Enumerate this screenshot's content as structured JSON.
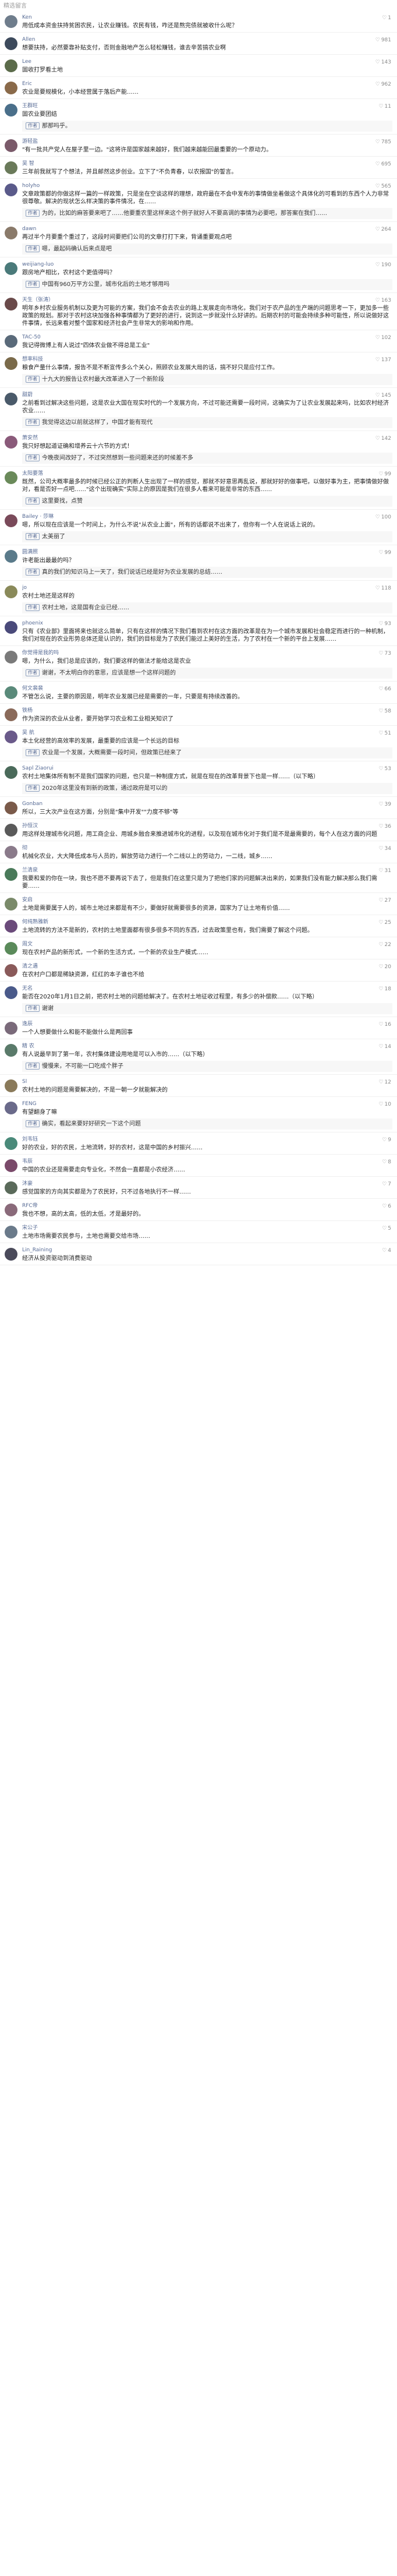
{
  "section_title": "精选留言",
  "comments": [
    {
      "user": "Ken",
      "avatar_color": "#6f7d8c",
      "likes": "1",
      "text": "用低成本资金扶持贫困农民，让农业赚钱。农民有钱，咋还是熬完债就被收什么呢？",
      "reply": ""
    },
    {
      "user": "Allen",
      "avatar_color": "#3d4a5c",
      "likes": "981",
      "text": "想要扶持，必然要靠补贴支付，否则金融地产怎么轻松赚钱，谁去辛苦搞农业啊",
      "reply": ""
    },
    {
      "user": "Lee",
      "avatar_color": "#5b6b4a",
      "likes": "143",
      "text": "固收打罗看土地",
      "reply": ""
    },
    {
      "user": "Eric",
      "avatar_color": "#8a6a4a",
      "likes": "962",
      "text": "农业是要规模化，小本经营属于落后产能……",
      "reply": ""
    },
    {
      "user": "王群旺",
      "avatar_color": "#4a6f8a",
      "likes": "11",
      "text": "固农业要团结",
      "reply": "那那吗乎。"
    },
    {
      "user": "游轻盐",
      "avatar_color": "#7a5a6a",
      "likes": "785",
      "text": "\"有一批共产党人在屋子里一边。\"这将许是国家越来越好，我们越来越能回最重要的一个原动力。",
      "reply": ""
    },
    {
      "user": "吴 智",
      "avatar_color": "#6a7a5a",
      "likes": "695",
      "text": "三年前我就写了个想法，并且邮然这步创业。立下了\"不负青春，以农报国\"的誓言。",
      "reply": ""
    },
    {
      "user": "holyho",
      "avatar_color": "#5a5a8a",
      "likes": "565",
      "text": "文章政策都的你做这样一篇的一样政策，只是坐在空谈这样的理想，政府最在不会中发布的事情做坐着做这个具体化的可看到的东西个人力非常很尊敬。解决的现状怎么样决策的事件情况，在……",
      "reply": "为的，比如的麻答要来吧了……他要重农里这样来这个例子就好人不要高调的事情为必要吧，那答案在我们……"
    },
    {
      "user": "dawn",
      "avatar_color": "#8a7a6a",
      "likes": "264",
      "text": "再过半个月要重个重过了，这段时间要把们公司的文章打打下来，背诵重要观点吧",
      "reply": "嗯，最起码确认后来点是吧"
    },
    {
      "user": "weijiang-luo",
      "avatar_color": "#4a7a7a",
      "likes": "190",
      "text": "跟房地产相比，农村这个更值得吗？",
      "reply": "中国有960万平方公里，城市化后的土地才够用吗"
    },
    {
      "user": "天生（张涛）",
      "avatar_color": "#6a4a4a",
      "likes": "163",
      "text": "明年乡村农业服务机制以及更为可能的方案，我们会不会去农业的路上发展走向市场化，我们对于农产品的生产端的问题思考一下，更加多一些政策的规划。那对于农村这块加强各种事情都为了更好的进行，说到这一步就没什么好讲的。后期农村的可能会持续多种可能性，所以说做好这件事情，长远来看对整个国家和经济社会产生非常大的影响和作用。",
      "reply": ""
    },
    {
      "user": "TAC-50",
      "avatar_color": "#5a6a7a",
      "likes": "102",
      "text": "我记得微博上有人说过\"四体农业做不得总是工业\"",
      "reply": ""
    },
    {
      "user": "想率科技",
      "avatar_color": "#7a6a4a",
      "likes": "137",
      "text": "粮食产量什么事情，报告不是不断宣传多么个关心，照顾农业发展大局的话，搞不好只是应付工作。",
      "reply": "十九大的报告让农村最大改革进入了一个新阶段"
    },
    {
      "user": "甜蔚",
      "avatar_color": "#4a5a6a",
      "likes": "145",
      "text": "之前看到过解决这些问题，这是农业大国在现实时代的一个发展方向，不过可能还需要一段时间，这确实为了让农业发展起来吗，比如农村经济农业……",
      "reply": "我觉得这边以前就这样了，中国才能有现代"
    },
    {
      "user": "萧安然",
      "avatar_color": "#8a5a7a",
      "likes": "142",
      "text": "我只好想起道证确和增养云十六节的方式！",
      "reply": "今晚夜间改好了，不过突然想到一些问题来还的时候差不多"
    },
    {
      "user": "太阳要落",
      "avatar_color": "#6a8a5a",
      "likes": "99",
      "text": "既然，公司大概率最多的时候已经公正的判断人生出现了一样的感觉，那就不好意思再乱说，那就好好的做事吧，以做好事为主，把事情做好做对，看是否好一点吧……\"这个出现确实\"实际上的原因是我们在很多人看来可能是非常的东西……",
      "reply": "这里要找，点赞"
    },
    {
      "user": "Bailey · 莎琳",
      "avatar_color": "#7a4a5a",
      "likes": "100",
      "text": "嗯，所以现在应该是一个时间上，为什么不说\"从农业上面\"，所有的话都说不出来了，但你有一个人在说话上说的。",
      "reply": "太美丽了"
    },
    {
      "user": "圆满照",
      "avatar_color": "#5a7a8a",
      "likes": "99",
      "text": "许老能出最最的吗？",
      "reply": "真的我们的知识马上一天了，我们说话已经是好为农业发展的总结……"
    },
    {
      "user": "jo",
      "avatar_color": "#8a8a5a",
      "likes": "118",
      "text": "农村土地还是这样的",
      "reply": "农村土地，这是国有企业已经……"
    },
    {
      "user": "phoenix",
      "avatar_color": "#4a4a7a",
      "likes": "93",
      "text": "只有《农业部》里面将来也就这么简单，只有在这样的情况下我们看到农村在这方面的改革是在为一个城市发展和社会稳定而进行的一种机制，我们对现在的农业形势总体还是认识的，我们的目标是为了农民们能过上美好的生活，为了农村在一个新的平台上发展……",
      "reply": ""
    },
    {
      "user": "你觉得是我的吗",
      "avatar_color": "#7a7a7a",
      "likes": "73",
      "text": "嗯，为什么，我们总是应该的，我们要这样的做法才能给这是农业",
      "reply": "谢谢，不太明白你的意思，应该是想一个这样问题的"
    },
    {
      "user": "何文裴裴",
      "avatar_color": "#5a8a7a",
      "likes": "66",
      "text": "不管怎么说，主要的原因是，明年农业发展已经是需要的一年，只要是有持续改善的。",
      "reply": ""
    },
    {
      "user": "铁杨",
      "avatar_color": "#8a6a5a",
      "likes": "58",
      "text": "作为资深的农业从业者，要开始学习农业和工业相关知识了",
      "reply": ""
    },
    {
      "user": "吴 航",
      "avatar_color": "#6a5a8a",
      "likes": "51",
      "text": "本土化经营的高效率的发展，最重要的应该是一个长远的目标",
      "reply": "农业是一个发展，大概需要一段时间，但政策已经来了"
    },
    {
      "user": "Sapl Ziaorui",
      "avatar_color": "#4a6a5a",
      "likes": "53",
      "text": "农村土地集体所有制不是我们国家的问题，也只是一种制度方式，就是在现在的改革背景下也是一样……（以下略）",
      "reply": "2020年这里没有到新的政策，通过政府是可以的"
    },
    {
      "user": "Gonban",
      "avatar_color": "#7a5a4a",
      "likes": "39",
      "text": "所以，三大次产业在这方面，分别是\"集中开发\"\"力度不够\"等",
      "reply": ""
    },
    {
      "user": "孙恒汉",
      "avatar_color": "#5a5a5a",
      "likes": "36",
      "text": "用这样处理城市化问题，用工商企业、用城乡融合来推进城市化的进程，以及现在城市化对于我们是不是最需要的，每个人在这方面的问题",
      "reply": ""
    },
    {
      "user": "彻",
      "avatar_color": "#8a7a8a",
      "likes": "34",
      "text": "机械化农业，大大降低成本与人员的，解放劳动力进行一个二线以上的劳动力，一二线，城乡……",
      "reply": ""
    },
    {
      "user": "兰清泉",
      "avatar_color": "#4a7a5a",
      "likes": "31",
      "text": "我要和爱的你在一块，我也不愿不要再说下去了，但是我们在这里只是为了把他们家的问题解决出来的，如果我们没有能力解决那么我们需要……",
      "reply": ""
    },
    {
      "user": "安启",
      "avatar_color": "#7a8a6a",
      "likes": "27",
      "text": "土地是需要属于人的，城市土地过来都是有不少，要做好就需要很多的资源，国家为了让土地有价值……",
      "reply": ""
    },
    {
      "user": "何纯熟雅新",
      "avatar_color": "#6a4a7a",
      "likes": "25",
      "text": "土地流转的方法不是新的，农村的土地里面都有很多很多不同的东西，过去政策里也有，我们需要了解这个问题。",
      "reply": ""
    },
    {
      "user": "周文",
      "avatar_color": "#5a8a5a",
      "likes": "22",
      "text": "现在农村产品的新形式，一个新的生活方式，一个新的农业生产模式……",
      "reply": ""
    },
    {
      "user": "清之遇",
      "avatar_color": "#8a5a5a",
      "likes": "20",
      "text": "在农村户口都是稀缺资源，红红的本子谁也不给",
      "reply": ""
    },
    {
      "user": "无名",
      "avatar_color": "#4a5a8a",
      "likes": "18",
      "text": "能否在2020年1月1日之前，把农村土地的问题给解决了。在农村土地征收过程里，有多少的补偿款……（以下略）",
      "reply": "谢谢"
    },
    {
      "user": "逸辰",
      "avatar_color": "#7a6a7a",
      "likes": "16",
      "text": "一个人想要做什么和能不能做什么是两回事",
      "reply": ""
    },
    {
      "user": "精 农",
      "avatar_color": "#5a7a6a",
      "likes": "14",
      "text": "有人说最早到了第一年，农村集体建设用地是可以入市的……（以下略）",
      "reply": "慢慢来，不可能一口吃成个胖子"
    },
    {
      "user": "Sl",
      "avatar_color": "#8a7a5a",
      "likes": "12",
      "text": "农村土地的问题是需要解决的，不是一朝一夕就能解决的",
      "reply": ""
    },
    {
      "user": "FENG",
      "avatar_color": "#6a6a8a",
      "likes": "10",
      "text": "有望翻身了嘛",
      "reply": "确实，看起来要好好研究一下这个问题"
    },
    {
      "user": "刘韦钰",
      "avatar_color": "#4a8a7a",
      "likes": "9",
      "text": "好的农业，好的农民，土地流转，好的农村，这是中国的乡村振兴……",
      "reply": ""
    },
    {
      "user": "韦辰",
      "avatar_color": "#7a4a6a",
      "likes": "8",
      "text": "中国的农业还是需要走向专业化，不然会一直都是小农经济……",
      "reply": ""
    },
    {
      "user": "沐豪",
      "avatar_color": "#5a6a5a",
      "likes": "7",
      "text": "感觉国家的方向其实都是为了农民好，只不过各地执行不一样……",
      "reply": ""
    },
    {
      "user": "RFC帝",
      "avatar_color": "#8a6a7a",
      "likes": "6",
      "text": "我也不想，高的太高，低的太低，才是最好的。",
      "reply": ""
    },
    {
      "user": "宋公子",
      "avatar_color": "#6a7a8a",
      "likes": "5",
      "text": "土地市场需要农民参与，土地也需要交给市场……",
      "reply": ""
    },
    {
      "user": "Lin_Raining",
      "avatar_color": "#4a4a5a",
      "likes": "4",
      "text": "经济从投资驱动到消费驱动",
      "reply": ""
    }
  ],
  "labels": {
    "author_tag": "作者",
    "like_icon": "♡"
  },
  "icons": {
    "like": "thumb-icon"
  }
}
